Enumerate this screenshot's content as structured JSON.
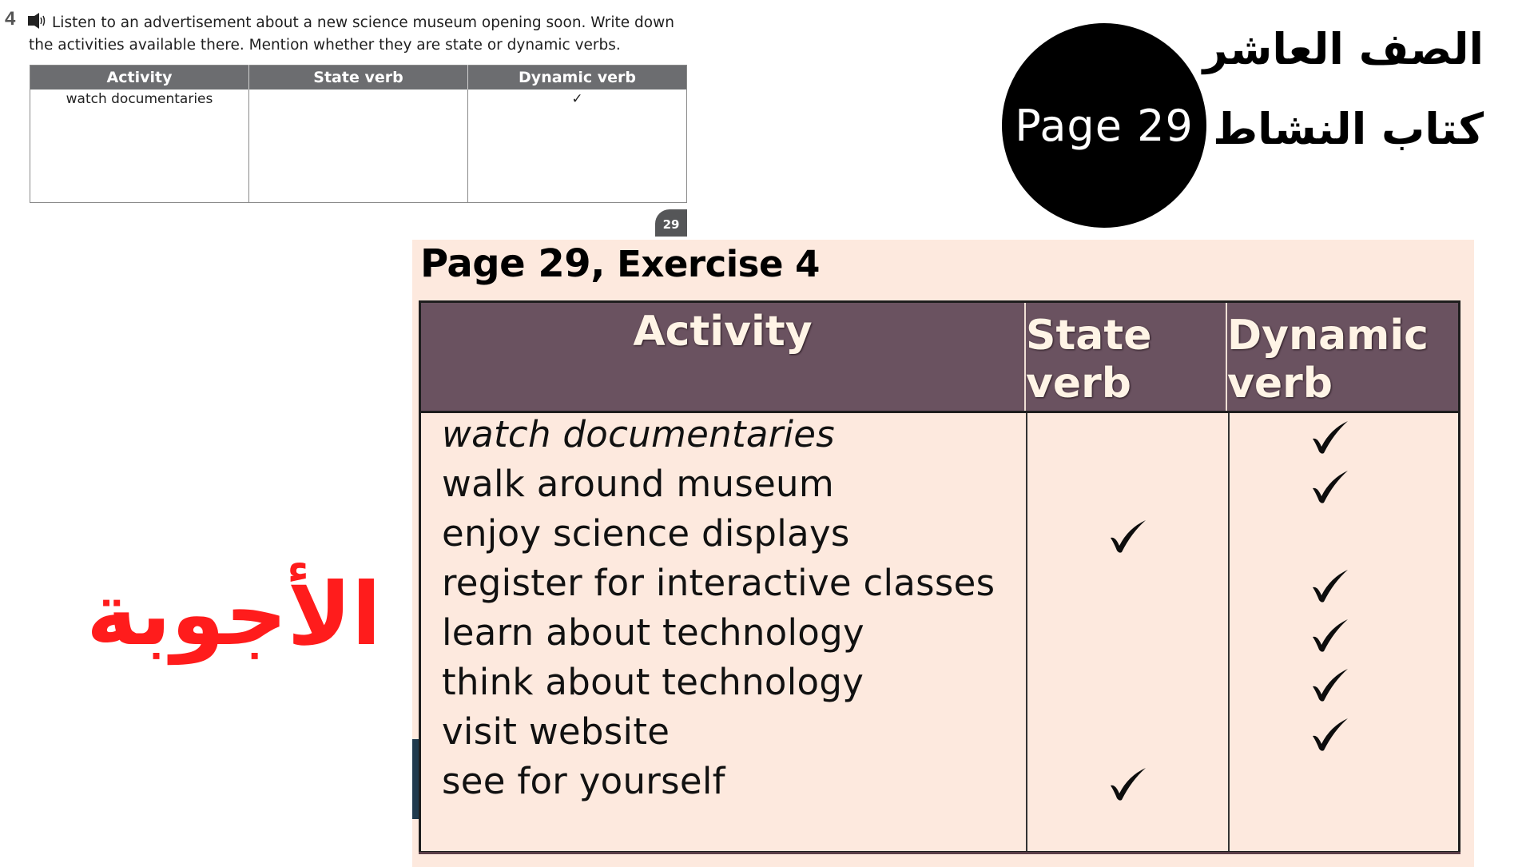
{
  "workbook": {
    "exercise_number": "4",
    "audio_icon": "speaker-icon",
    "instruction_line1": "Listen to an advertisement about a new science museum opening soon. Write down",
    "instruction_line2": "the activities available there. Mention whether they are state or dynamic verbs.",
    "table": {
      "headers": [
        "Activity",
        "State verb",
        "Dynamic verb"
      ],
      "example_row": {
        "activity": "watch documentaries",
        "state": "",
        "dynamic": "✓"
      }
    },
    "page_tab": "29"
  },
  "badge": {
    "label": "Page 29"
  },
  "arabic_titles": {
    "grade": "الصف العاشر",
    "book": "كتاب النشاط",
    "answers": "الأجوبة"
  },
  "answer_key": {
    "title_main": "Page 29,",
    "title_exercise": " Exercise 4",
    "headers": {
      "activity": "Activity",
      "state_line1": "State",
      "state_line2": "verb",
      "dynamic_line1": "Dynamic",
      "dynamic_line2": "verb"
    },
    "rows": [
      {
        "activity": "watch documentaries",
        "state": false,
        "dynamic": true,
        "italic": true
      },
      {
        "activity": "walk around museum",
        "state": false,
        "dynamic": true
      },
      {
        "activity": "enjoy science displays",
        "state": true,
        "dynamic": false
      },
      {
        "activity": "register for interactive classes",
        "state": false,
        "dynamic": true
      },
      {
        "activity": "learn about technology",
        "state": false,
        "dynamic": true
      },
      {
        "activity": "think about technology",
        "state": false,
        "dynamic": true
      },
      {
        "activity": "visit website",
        "state": false,
        "dynamic": true
      },
      {
        "activity": "see for yourself",
        "state": true,
        "dynamic": false
      }
    ]
  },
  "colors": {
    "header_bg": "#6a5260",
    "panel_bg": "#fde9de",
    "answers_red": "#ff1c1c",
    "workbook_header_bg": "#6c6d70"
  }
}
